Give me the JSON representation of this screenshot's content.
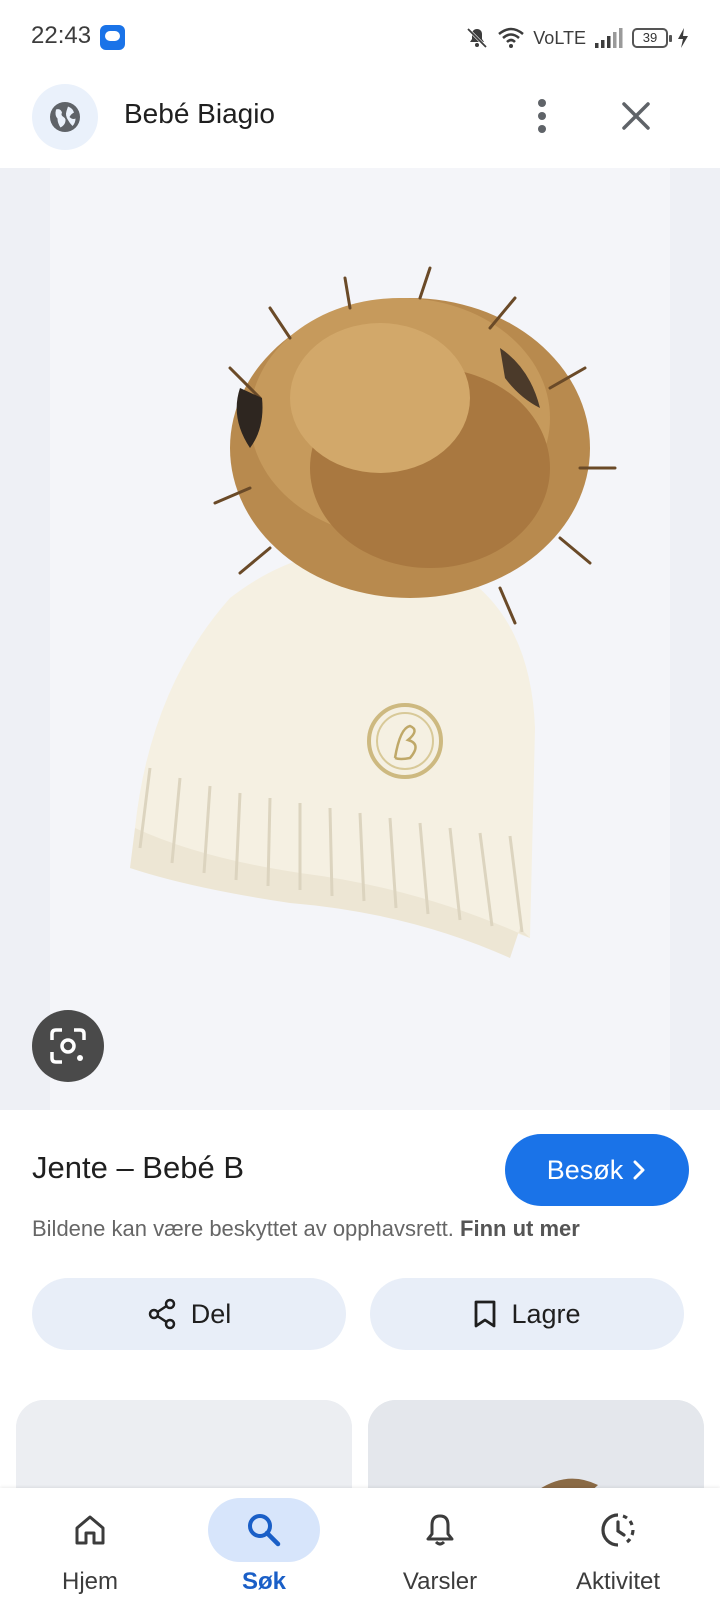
{
  "status_bar": {
    "time": "22:43",
    "network": "VoLTE",
    "battery": "39",
    "icons": [
      "chat-app-icon",
      "mute-bell-icon",
      "wifi-icon",
      "signal-icon",
      "battery-icon",
      "charging-icon"
    ]
  },
  "app_bar": {
    "site_name": "Bebé Biagio",
    "icons": [
      "globe-icon",
      "more-vert-icon",
      "close-icon"
    ]
  },
  "result": {
    "title": "Jente – Bebé B",
    "visit_label": "Besøk",
    "copyright_text": "Bildene kan være beskyttet av opphavsrett.",
    "learn_more": "Finn ut mer",
    "share_label": "Del",
    "save_label": "Lagre"
  },
  "bottom_nav": {
    "items": [
      {
        "label": "Hjem",
        "icon": "home-icon"
      },
      {
        "label": "Søk",
        "icon": "search-icon",
        "active": true
      },
      {
        "label": "Varsler",
        "icon": "bell-icon"
      },
      {
        "label": "Aktivitet",
        "icon": "activity-icon"
      }
    ]
  },
  "colors": {
    "accent": "#1a73e8",
    "pill": "#e8eef8",
    "active_nav": "#d7e5fb"
  }
}
